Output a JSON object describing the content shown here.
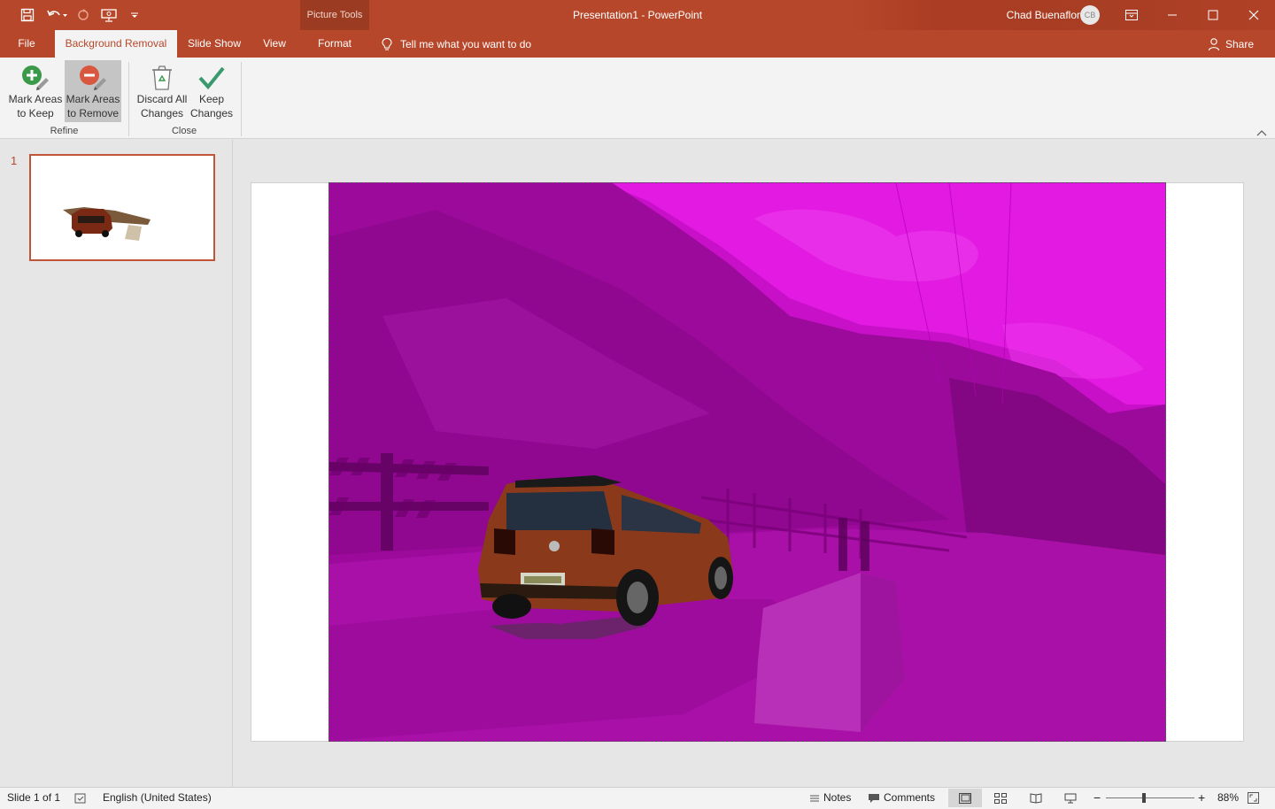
{
  "window": {
    "doc_title": "Presentation1  -  PowerPoint",
    "contextual_group": "Picture Tools",
    "user_name": "Chad Buenaflor",
    "user_initials": "CB"
  },
  "tabs": [
    {
      "label": "File"
    },
    {
      "label": "Background Removal"
    },
    {
      "label": "Slide Show"
    },
    {
      "label": "View"
    },
    {
      "label": "Format"
    }
  ],
  "tell_me": "Tell me what you want to do",
  "share": "Share",
  "ribbon": {
    "refine": {
      "label": "Refine",
      "mark_keep": {
        "line1": "Mark Areas",
        "line2": "to Keep"
      },
      "mark_remove": {
        "line1": "Mark Areas",
        "line2": "to Remove"
      }
    },
    "close": {
      "label": "Close",
      "discard": {
        "line1": "Discard All",
        "line2": "Changes"
      },
      "keep": {
        "line1": "Keep",
        "line2": "Changes"
      }
    }
  },
  "thumbnails": [
    {
      "number": "1"
    }
  ],
  "status": {
    "slide_info": "Slide 1 of 1",
    "language": "English (United States)",
    "notes": "Notes",
    "comments": "Comments",
    "zoom_label": "88%",
    "zoom_value": 88
  },
  "colors": {
    "accent": "#b7472a",
    "removal_overlay": "#c40bc4",
    "car_body": "#8a3a1a"
  },
  "icons": {
    "mark_keep": "plus-pencil-icon",
    "mark_remove": "minus-pencil-icon",
    "discard": "recycle-bin-icon",
    "keep": "checkmark-icon"
  }
}
